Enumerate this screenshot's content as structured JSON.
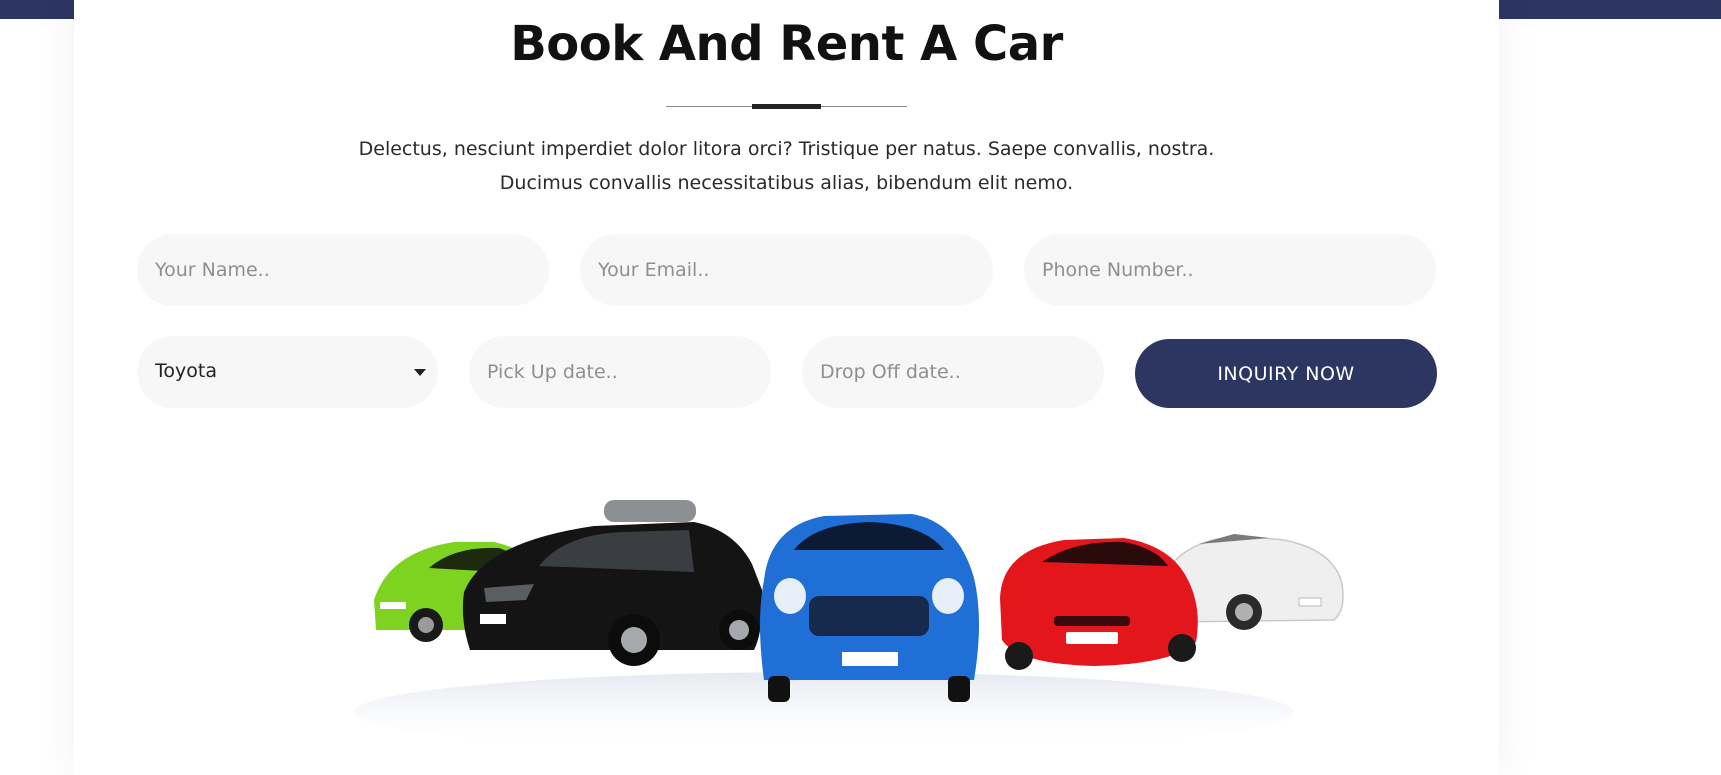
{
  "heading": "Book And Rent A Car",
  "description": {
    "line1": "Delectus, nesciunt imperdiet dolor litora orci? Tristique per natus. Saepe convallis, nostra.",
    "line2": "Ducimus convallis necessitatibus alias, bibendum elit nemo."
  },
  "form": {
    "name_placeholder": "Your Name..",
    "email_placeholder": "Your Email..",
    "phone_placeholder": "Phone Number..",
    "car_select_value": "Toyota",
    "pickup_placeholder": "Pick Up date..",
    "dropoff_placeholder": "Drop Off date..",
    "submit_label": "INQUIRY NOW"
  },
  "image": {
    "icon": "cars-lineup-image",
    "car_colors": [
      "#7ed321",
      "#1a1a1a",
      "#1f6fd6",
      "#e3161b",
      "#f2f2f2"
    ]
  },
  "colors": {
    "accent": "#2d3561",
    "field_bg": "#f7f7f7",
    "heading": "#111111"
  }
}
